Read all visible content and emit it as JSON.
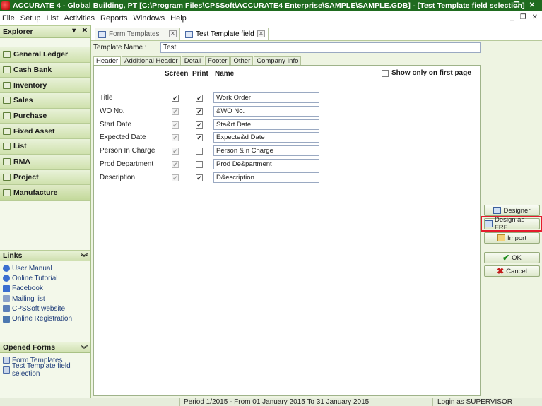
{
  "window": {
    "title": "ACCURATE 4 - Global Building, PT   [C:\\Program Files\\CPSSoft\\ACCURATE4 Enterprise\\SAMPLE\\SAMPLE.GDB] - [Test Template field selection]",
    "controls": [
      "_",
      "❐",
      "✕"
    ],
    "mdi_controls": [
      "_",
      "❐",
      "✕"
    ]
  },
  "menu": [
    "File",
    "Setup",
    "List",
    "Activities",
    "Reports",
    "Windows",
    "Help"
  ],
  "sidebar": {
    "explorer_title": "Explorer",
    "explorer_ctrls": [
      "▾",
      "✕"
    ],
    "modules": [
      {
        "label": "General Ledger",
        "icon": "ledger-icon"
      },
      {
        "label": "Cash Bank",
        "icon": "cash-bank-icon"
      },
      {
        "label": "Inventory",
        "icon": "inventory-icon"
      },
      {
        "label": "Sales",
        "icon": "sales-icon"
      },
      {
        "label": "Purchase",
        "icon": "purchase-icon"
      },
      {
        "label": "Fixed Asset",
        "icon": "fixed-asset-icon"
      },
      {
        "label": "List",
        "icon": "list-icon"
      },
      {
        "label": "RMA",
        "icon": "rma-icon"
      },
      {
        "label": "Project",
        "icon": "project-icon"
      },
      {
        "label": "Manufacture",
        "icon": "manufacture-icon"
      }
    ],
    "links_title": "Links",
    "links": [
      {
        "label": "User Manual",
        "icon": "help-icon"
      },
      {
        "label": "Online Tutorial",
        "icon": "help-icon"
      },
      {
        "label": "Facebook",
        "icon": "facebook-icon"
      },
      {
        "label": "Mailing list",
        "icon": "mail-icon"
      },
      {
        "label": "CPSSoft website",
        "icon": "website-icon"
      },
      {
        "label": "Online Registration",
        "icon": "registration-icon"
      }
    ],
    "opened_title": "Opened Forms",
    "opened_forms": [
      {
        "label": "Form Templates",
        "icon": "form-icon"
      },
      {
        "label": "Test Template field selection",
        "icon": "form-icon"
      }
    ]
  },
  "doc_tabs": [
    {
      "label": "Form Templates",
      "active": false
    },
    {
      "label": "Test Template field ...",
      "active": true
    }
  ],
  "form": {
    "template_name_label": "Template Name :",
    "template_name_value": "Test",
    "sub_tabs": [
      "Header",
      "Additional Header",
      "Detail",
      "Footer",
      "Other",
      "Company Info"
    ],
    "col_screen": "Screen",
    "col_print": "Print",
    "col_name": "Name",
    "show_first_label": "Show only on first page",
    "show_first_checked": false,
    "fields": [
      {
        "label": "Title",
        "screen": true,
        "screen_disabled": false,
        "print": true,
        "name": "Work Order"
      },
      {
        "label": "WO No.",
        "screen": true,
        "screen_disabled": true,
        "print": true,
        "name": "&WO No."
      },
      {
        "label": "Start Date",
        "screen": true,
        "screen_disabled": true,
        "print": true,
        "name": "Sta&rt Date"
      },
      {
        "label": "Expected Date",
        "screen": true,
        "screen_disabled": true,
        "print": true,
        "name": "Expecte&d Date"
      },
      {
        "label": "Person In Charge",
        "screen": true,
        "screen_disabled": true,
        "print": false,
        "name": "Person &In Charge"
      },
      {
        "label": "Prod Department",
        "screen": true,
        "screen_disabled": true,
        "print": false,
        "name": "Prod De&partment"
      },
      {
        "label": "Description",
        "screen": true,
        "screen_disabled": true,
        "print": true,
        "name": "D&escription"
      }
    ]
  },
  "buttons": {
    "designer": "Designer",
    "design_frf": "Design as FRF",
    "import": "Import",
    "ok": "OK",
    "cancel": "Cancel"
  },
  "status": {
    "period": "Period 1/2015 - From 01 January 2015 To 31 January 2015",
    "login": "Login as SUPERVISOR"
  },
  "colors": {
    "titlebar": "#1f6b1f",
    "highlight": "#e41b2c"
  }
}
